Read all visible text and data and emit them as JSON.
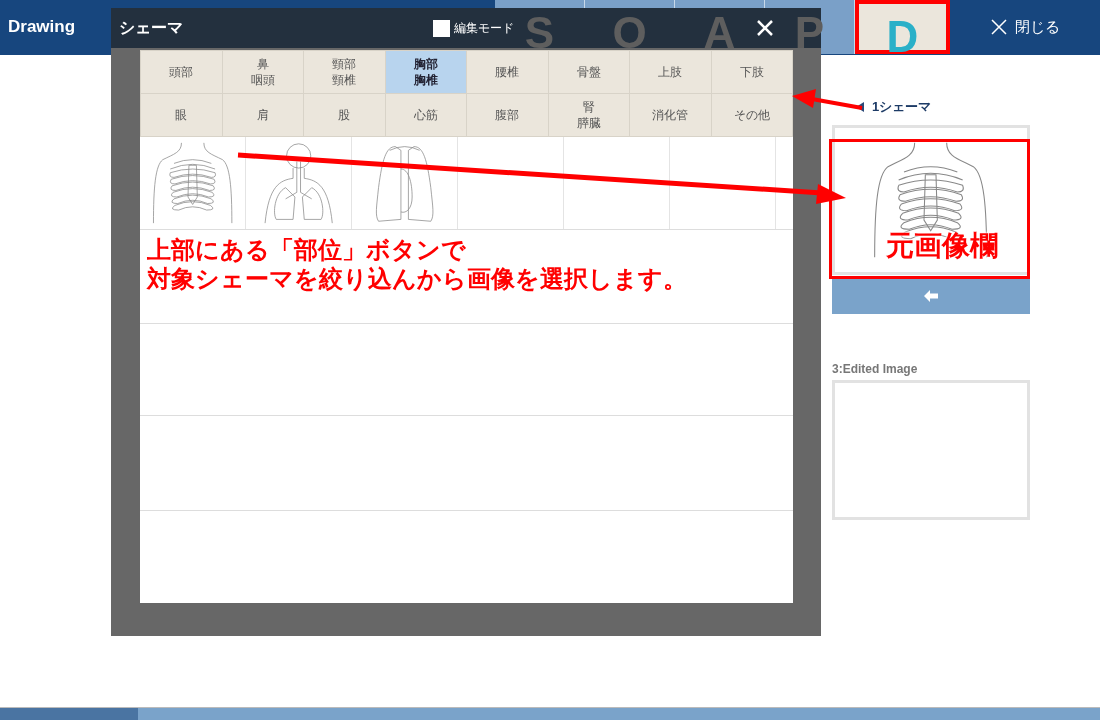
{
  "app_bar": {
    "title": "Drawing",
    "tabs": [
      {
        "label": "S",
        "selected": false
      },
      {
        "label": "O",
        "selected": false
      },
      {
        "label": "A",
        "selected": false
      },
      {
        "label": "P",
        "selected": false
      },
      {
        "label": "D",
        "selected": true
      }
    ],
    "close_label": "閉じる"
  },
  "dialog": {
    "title": "シェーマ",
    "edit_mode": {
      "label": "編集モード",
      "checked": false
    },
    "body_parts": [
      {
        "lines": [
          "頭部"
        ],
        "selected": false
      },
      {
        "lines": [
          "鼻",
          "咽頭"
        ],
        "selected": false
      },
      {
        "lines": [
          "頸部",
          "頸椎"
        ],
        "selected": false
      },
      {
        "lines": [
          "胸部",
          "胸椎"
        ],
        "selected": true
      },
      {
        "lines": [
          "腰椎"
        ],
        "selected": false
      },
      {
        "lines": [
          "骨盤"
        ],
        "selected": false
      },
      {
        "lines": [
          "上肢"
        ],
        "selected": false
      },
      {
        "lines": [
          "下肢"
        ],
        "selected": false
      },
      {
        "lines": [
          "眼"
        ],
        "selected": false
      },
      {
        "lines": [
          "肩"
        ],
        "selected": false
      },
      {
        "lines": [
          "股"
        ],
        "selected": false
      },
      {
        "lines": [
          "心筋"
        ],
        "selected": false
      },
      {
        "lines": [
          "腹部"
        ],
        "selected": false
      },
      {
        "lines": [
          "腎",
          "膵臓"
        ],
        "selected": false
      },
      {
        "lines": [
          "消化管"
        ],
        "selected": false
      },
      {
        "lines": [
          "その他"
        ],
        "selected": false
      }
    ],
    "thumbnails": [
      {
        "kind": "ribcage"
      },
      {
        "kind": "airway"
      },
      {
        "kind": "lungs"
      },
      {
        "kind": "empty"
      },
      {
        "kind": "empty"
      },
      {
        "kind": "empty"
      }
    ]
  },
  "side_panel": {
    "schema_label": "1シェーマ",
    "source_image": {
      "kind": "ribcage"
    },
    "edited_label": "3:Edited Image"
  },
  "annotations": {
    "instruction_lines": [
      "上部にある「部位」ボタンで",
      "対象シェーマを絞り込んから画像を選択します。"
    ],
    "source_label": "元画像欄"
  }
}
